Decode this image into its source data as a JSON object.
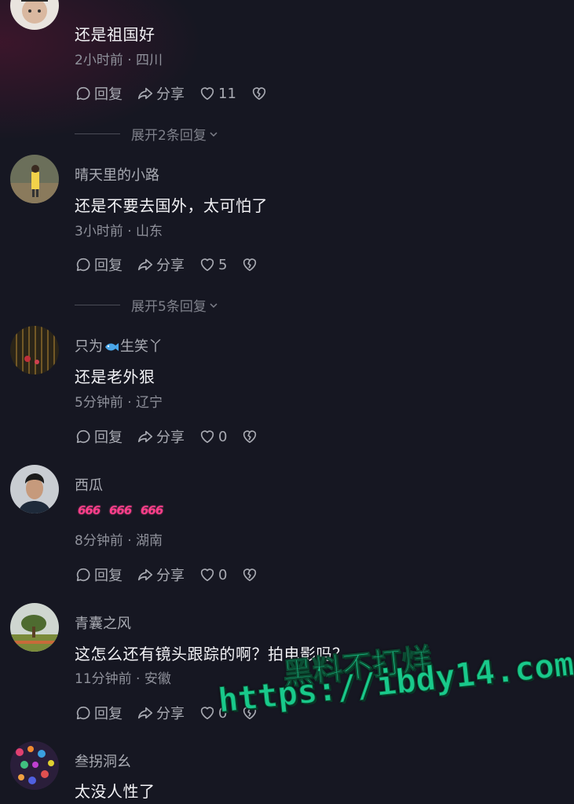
{
  "actions": {
    "reply": "回复",
    "share": "分享"
  },
  "comments": [
    {
      "username": "",
      "text": "还是祖国好",
      "meta": "2小时前 · 四川",
      "likes": "11",
      "expand": "展开2条回复"
    },
    {
      "username": "晴天里的小路",
      "text": "还是不要去国外，太可怕了",
      "meta": "3小时前 · 山东",
      "likes": "5",
      "expand": "展开5条回复"
    },
    {
      "username_prefix": "只为",
      "username_suffix": "生笑丫",
      "text": "还是老外狠",
      "meta": "5分钟前 · 辽宁",
      "likes": "0"
    },
    {
      "username": "西瓜",
      "emojis": [
        "666",
        "666",
        "666"
      ],
      "meta": "8分钟前 · 湖南",
      "likes": "0"
    },
    {
      "username": "青囊之风",
      "text": "这怎么还有镜头跟踪的啊？拍电影吗？",
      "meta": "11分钟前 · 安徽",
      "likes": "0"
    },
    {
      "username": "叁拐洞幺",
      "text": "太没人性了"
    }
  ],
  "watermark": {
    "line1": "黑料不打烊",
    "line2": "https://ibdy14.com"
  },
  "colors": {
    "background": "#161722",
    "text_primary": "#f2f2f5",
    "text_secondary": "#a9abb3",
    "watermark": "#19c98b",
    "emoji_666": "#ff3e8a"
  }
}
